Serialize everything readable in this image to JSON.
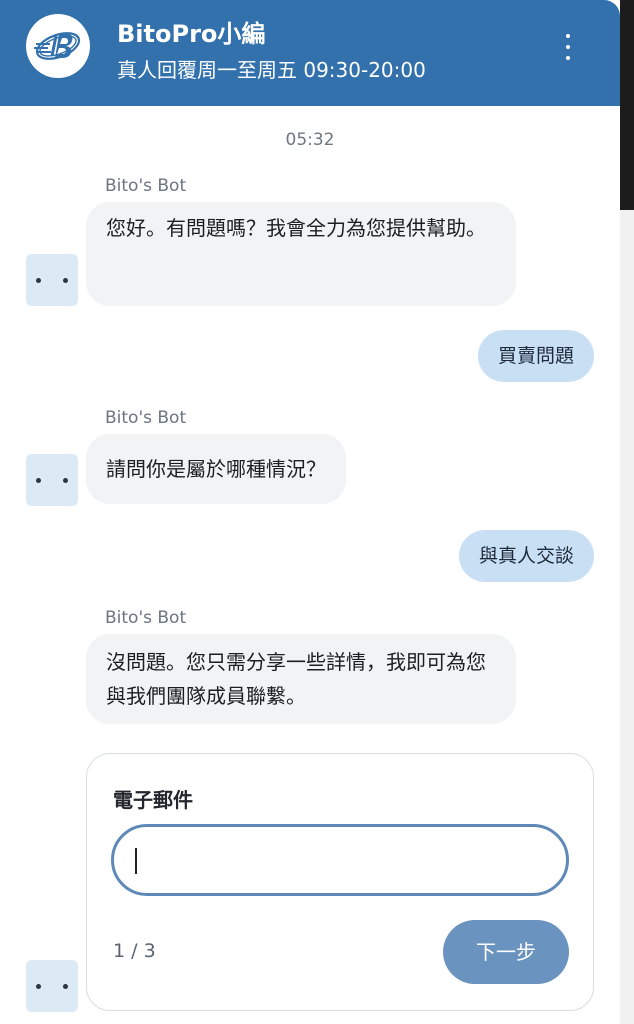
{
  "header": {
    "agent_name": "BitoPro小編",
    "hours": "真人回覆周一至周五 09:30-20:00",
    "logo_icon": "bitopro-logo",
    "menu_icon": "more-vertical-icon",
    "color": "#3271ac"
  },
  "conversation": {
    "timestamp": "05:32",
    "messages": [
      {
        "from": "bot",
        "sender": "Bito's Bot",
        "text": "您好。有問題嗎？我會全力為您提供幫助。"
      },
      {
        "from": "user",
        "text": "買賣問題"
      },
      {
        "from": "bot",
        "sender": "Bito's Bot",
        "text": "請問你是屬於哪種情況？"
      },
      {
        "from": "user",
        "text": "與真人交談"
      },
      {
        "from": "bot",
        "sender": "Bito's Bot",
        "text": "沒問題。您只需分享一些詳情，我即可為您與我們團隊成員聯繫。"
      }
    ]
  },
  "form": {
    "label": "電子郵件",
    "value": "",
    "step": "1 / 3",
    "next_label": "下一步"
  },
  "colors": {
    "bot_bubble": "#f2f3f5",
    "user_bubble": "#c9e0f4",
    "next_button": "#6a93c0",
    "avatar_bg": "#dbeaf5"
  }
}
